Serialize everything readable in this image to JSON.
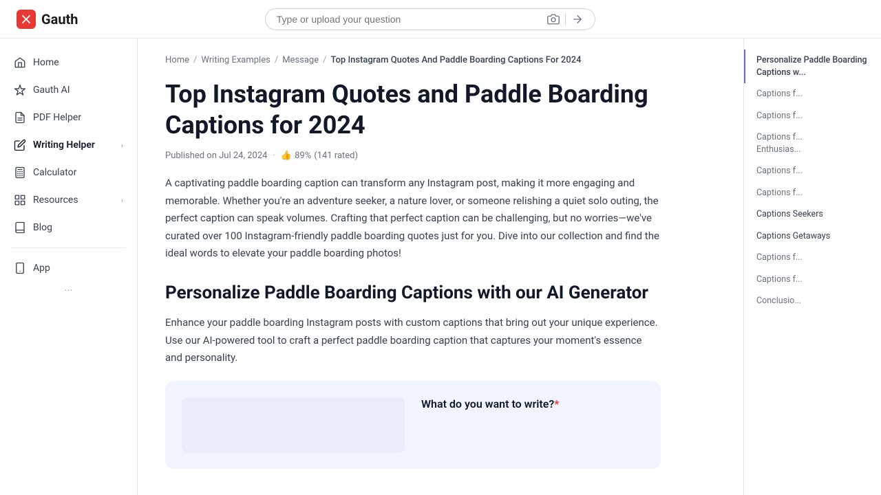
{
  "header": {
    "logo_text": "Gauth",
    "logo_icon": "X",
    "search_placeholder": "Type or upload your question"
  },
  "sidebar": {
    "items": [
      {
        "id": "home",
        "label": "Home",
        "icon": "home",
        "has_chevron": false
      },
      {
        "id": "gauth-ai",
        "label": "Gauth AI",
        "icon": "sparkle",
        "has_chevron": false
      },
      {
        "id": "pdf-helper",
        "label": "PDF Helper",
        "icon": "file",
        "has_chevron": false
      },
      {
        "id": "writing-helper",
        "label": "Writing Helper",
        "icon": "pencil",
        "has_chevron": true
      },
      {
        "id": "calculator",
        "label": "Calculator",
        "icon": "calculator",
        "has_chevron": false
      },
      {
        "id": "resources",
        "label": "Resources",
        "icon": "grid",
        "has_chevron": true
      },
      {
        "id": "blog",
        "label": "Blog",
        "icon": "book",
        "has_chevron": false
      },
      {
        "id": "app",
        "label": "App",
        "icon": "phone",
        "has_chevron": false
      }
    ]
  },
  "breadcrumb": {
    "items": [
      {
        "label": "Home",
        "href": true
      },
      {
        "label": "Writing Examples",
        "href": true
      },
      {
        "label": "Message",
        "href": true
      },
      {
        "label": "Top Instagram Quotes And Paddle Boarding Captions For 2024",
        "href": false
      }
    ]
  },
  "article": {
    "title": "Top Instagram Quotes and Paddle Boarding Captions for 2024",
    "published": "Published on Jul 24, 2024",
    "rating_percent": "89%",
    "rating_count": "141 rated",
    "intro": "A captivating paddle boarding caption can transform any Instagram post, making it more engaging and memorable. Whether you're an adventure seeker, a nature lover, or someone relishing a quiet solo outing, the perfect caption can speak volumes. Crafting that perfect caption can be challenging, but no worries—we've curated over 100 Instagram-friendly paddle boarding quotes just for you. Dive into our collection and find the ideal words to elevate your paddle boarding photos!",
    "section1_title": "Personalize Paddle Boarding Captions with our AI Generator",
    "section1_text": "Enhance your paddle boarding Instagram posts with custom captions that bring out your unique experience. Use our AI-powered tool to craft a perfect paddle boarding caption that captures your moment's essence and personality.",
    "cta_label": "What do you want to write?",
    "cta_asterisk": "*"
  },
  "toc": {
    "items": [
      {
        "id": "personalize",
        "label": "Personalize Paddle Boarding Captions with our AI Generator",
        "active": true
      },
      {
        "id": "captions-1",
        "label": "Captions f..."
      },
      {
        "id": "captions-2",
        "label": "Captions f..."
      },
      {
        "id": "captions-enthusiasts",
        "label": "Captions f... Enthusias..."
      },
      {
        "id": "captions-3",
        "label": "Captions f..."
      },
      {
        "id": "captions-4",
        "label": "Captions f..."
      },
      {
        "id": "captions-seekers",
        "label": "Captions Seekers"
      },
      {
        "id": "captions-getaways",
        "label": "Captions Getaways"
      },
      {
        "id": "captions-5",
        "label": "Captions f..."
      },
      {
        "id": "captions-6",
        "label": "Captions f..."
      },
      {
        "id": "conclusion",
        "label": "Conclusio..."
      }
    ]
  }
}
